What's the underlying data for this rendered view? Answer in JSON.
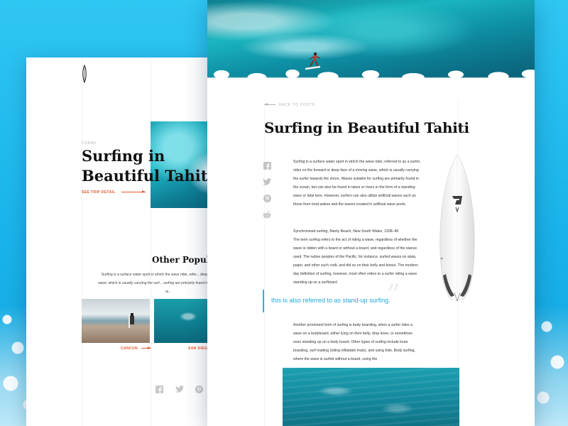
{
  "back_card": {
    "small_label": "TODAY",
    "title": "Surfing in Beautiful Tahiti",
    "see_trip": "SEE TRIP DETAIL",
    "subtitle": "Other Popular",
    "paragraph": "Surfing is a surface water sport in which the wave rider, refer... deep face of a moving wave, which is usually carrying the surf... surfing are primarily found in the ocean, but can al...",
    "thumbs": [
      {
        "caption": "CANCUN"
      },
      {
        "caption": "SAN DIEGO"
      }
    ],
    "social": [
      "facebook-icon",
      "twitter-icon",
      "pinterest-icon"
    ]
  },
  "front_card": {
    "back_to_posts": "BACK TO POSTS",
    "title": "Surfing in Beautiful Tahiti",
    "share": [
      "facebook-icon",
      "twitter-icon",
      "pinterest-icon",
      "reddit-icon"
    ],
    "paragraph_1": "Surfing is a surface water sport in which the wave rider, referred to as a surfer, rides on the forward or deep face of a moving wave, which is usually carrying the surfer towards the shore. Waves suitable for surfing are primarily found in the ocean, but can also be found in lakes or rivers in the form of a standing wave or tidal bore. However, surfers can also utilize artificial waves such as those from boat wakes and the waves created in artificial wave pools.",
    "paragraph_2_heading": "Synchronised surfing, Manly Beach, New South Wales, 1938–46",
    "paragraph_2": "The term surfing refers to the act of riding a wave, regardless of whether the wave is ridden with a board or without a board, and regardless of the stance used. The native peoples of the Pacific, for instance, surfed waves on alaia, paipo, and other such craft, and did so on their belly and knees. The modern-day definition of surfing, however, most often refers to a surfer riding a wave standing up on a surfboard",
    "quote": "this is also referred to as stand-up surfing.",
    "paragraph_3": "Another prominent form of surfing is body boarding, when a surfer rides a wave on a bodyboard, either lying on their belly, drop knee, or sometimes even standing up on a body board. Other types of surfing include knee boarding, surf matting (riding inflatable mats), and using foils. Body surfing, where the wave is surfed without a board, using the"
  },
  "colors": {
    "accent_orange": "#e4572e",
    "accent_blue": "#20a9db",
    "background_blue": "#19b3ea"
  }
}
